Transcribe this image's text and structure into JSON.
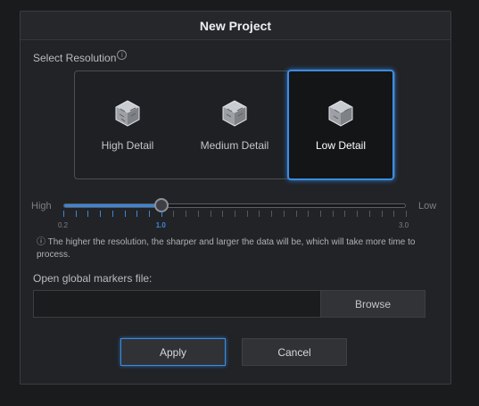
{
  "dialog": {
    "title": "New Project"
  },
  "resolution": {
    "label": "Select Resolution",
    "info_icon": "info-icon",
    "options": [
      {
        "label": "High Detail",
        "icon": "cube-icon",
        "selected": false
      },
      {
        "label": "Medium Detail",
        "icon": "cube-icon",
        "selected": false
      },
      {
        "label": "Low Detail",
        "icon": "cube-icon",
        "selected": true
      }
    ]
  },
  "slider": {
    "left_label": "High",
    "right_label": "Low",
    "min_label": "0.2",
    "current_label": "1.0",
    "max_label": "3.0",
    "min": 0.2,
    "max": 3.0,
    "value": 1.0,
    "tick_count": 29,
    "accent_color": "#3b86d9"
  },
  "note": {
    "text": "ⓘ The higher the resolution, the sharper and larger the data will be, which will take more time to process."
  },
  "markers": {
    "label": "Open global markers file:",
    "value": "",
    "placeholder": "",
    "browse_label": "Browse"
  },
  "footer": {
    "apply_label": "Apply",
    "cancel_label": "Cancel"
  }
}
